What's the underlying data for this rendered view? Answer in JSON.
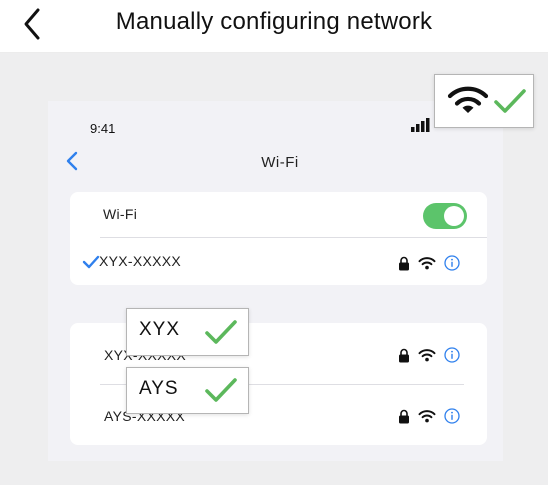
{
  "header": {
    "title": "Manually configuring network",
    "back_icon": "chevron-left-icon"
  },
  "phone": {
    "status_time": "9:41",
    "nav": {
      "back_icon": "chevron-left-icon",
      "title": "Wi-Fi"
    },
    "wifi_toggle": {
      "label": "Wi-Fi",
      "on": true,
      "color": "#5cc46b"
    },
    "connected_network": {
      "name": "XYX-XXXXX",
      "checked_color": "#2f80ed"
    },
    "networks": [
      {
        "name": "XYX-XXXXX"
      },
      {
        "name": "AYS-XXXXX"
      }
    ]
  },
  "callouts": [
    {
      "label": "XYX",
      "check_color": "#5cb85c"
    },
    {
      "label": "AYS",
      "check_color": "#5cb85c"
    }
  ],
  "wifi_badge": {
    "icon": "wifi-icon",
    "check_icon": "checkmark-icon"
  },
  "colors": {
    "ios_blue": "#2f80ed",
    "green_check": "#5cb85c"
  }
}
